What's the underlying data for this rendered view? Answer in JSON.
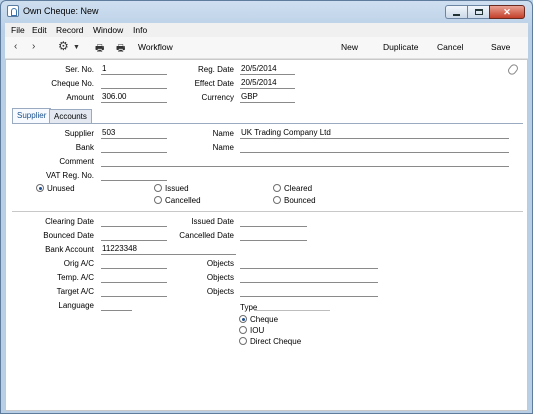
{
  "window": {
    "title": "Own Cheque: New"
  },
  "menu": [
    "File",
    "Edit",
    "Record",
    "Window",
    "Info"
  ],
  "toolbar": {
    "workflow": "Workflow",
    "new": "New",
    "duplicate": "Duplicate",
    "cancel": "Cancel",
    "save": "Save"
  },
  "header": {
    "ser_no_label": "Ser. No.",
    "ser_no": "1",
    "cheque_no_label": "Cheque No.",
    "cheque_no": "",
    "amount_label": "Amount",
    "amount": "306.00",
    "reg_date_label": "Reg. Date",
    "reg_date": "20/5/2014",
    "effect_date_label": "Effect Date",
    "effect_date": "20/5/2014",
    "currency_label": "Currency",
    "currency": "GBP"
  },
  "tabs": [
    "Supplier",
    "Accounts"
  ],
  "supplier": {
    "supplier_label": "Supplier",
    "supplier": "503",
    "name_label": "Name",
    "name": "UK Trading Company Ltd",
    "bank_label": "Bank",
    "bank": "",
    "bank_name_label": "Name",
    "bank_name": "",
    "comment_label": "Comment",
    "comment": "",
    "vat_label": "VAT Reg. No.",
    "vat": ""
  },
  "status_options": {
    "unused": "Unused",
    "issued": "Issued",
    "cleared": "Cleared",
    "cancelled": "Cancelled",
    "bounced": "Bounced"
  },
  "dates": {
    "clearing_label": "Clearing Date",
    "clearing": "",
    "issued_label": "Issued Date",
    "issued": "",
    "bounced_label": "Bounced Date",
    "bounced": "",
    "cancelled_label": "Cancelled Date",
    "cancelled": "",
    "bank_account_label": "Bank Account",
    "bank_account": "11223348"
  },
  "accounts": {
    "orig_label": "Orig A/C",
    "orig": "",
    "temp_label": "Temp. A/C",
    "temp": "",
    "target_label": "Target A/C",
    "target": "",
    "objects_label": "Objects",
    "objects1": "",
    "objects2": "",
    "objects3": "",
    "language_label": "Language",
    "language": ""
  },
  "type": {
    "label": "Type",
    "cheque": "Cheque",
    "iou": "IOU",
    "direct": "Direct Cheque"
  }
}
